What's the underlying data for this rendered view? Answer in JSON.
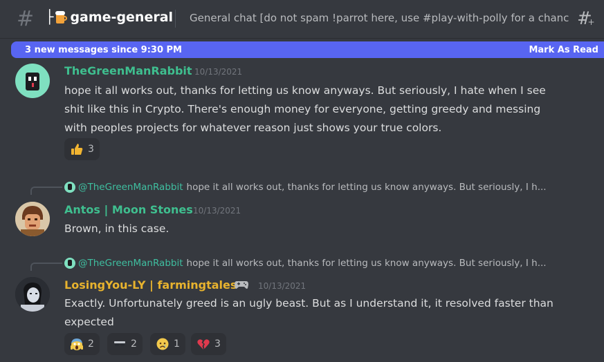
{
  "header": {
    "hash_glyph": "#",
    "channel_prefix": "├",
    "channel_name": "game-general",
    "topic": "General chat [do not spam !parrot here, use #play-with-polly for a chanc…"
  },
  "new_messages_bar": {
    "label": "3 new messages since 9:30 PM",
    "action": "Mark As Read"
  },
  "messages": [
    {
      "author": "TheGreenManRabbit",
      "author_color": "#3fbf8f",
      "timestamp": "10/13/2021",
      "lines": [
        "hope it all works out, thanks for letting us know anyways.  But seriously, I hate when I see",
        "shit like this in Crypto.  There's enough money for everyone, getting greedy and messing",
        "with peoples projects for whatever reason just shows your true colors."
      ],
      "reactions": [
        {
          "icon": "thumbs-up-icon",
          "count": "3"
        }
      ]
    },
    {
      "reply_to": "@TheGreenManRabbit",
      "reply_preview": "hope it all works out, thanks for letting us know anyways.  But seriously, I h...",
      "author": "Antos | Moon Stones",
      "author_color": "#3fbf8f",
      "timestamp": "10/13/2021",
      "lines": [
        "Brown, in this case."
      ]
    },
    {
      "reply_to": "@TheGreenManRabbit",
      "reply_preview": "hope it all works out, thanks for letting us know anyways.  But seriously, I h...",
      "author": "LosingYou-LY | farmingtales",
      "author_color": "#e8b32e",
      "timestamp": "10/13/2021",
      "lines": [
        "Exactly. Unfortunately greed is an ugly beast. But as I understand it, it resolved faster than",
        "expected"
      ],
      "reactions": [
        {
          "icon": "scream-icon",
          "count": "2"
        },
        {
          "icon": "sunglasses-icon",
          "count": "2"
        },
        {
          "icon": "crying-face-icon",
          "count": "1"
        },
        {
          "icon": "broken-heart-icon",
          "count": "3"
        }
      ]
    }
  ],
  "colors": {
    "background": "#36393f",
    "accent": "#5865f2",
    "mention": "#3fbfa0"
  }
}
